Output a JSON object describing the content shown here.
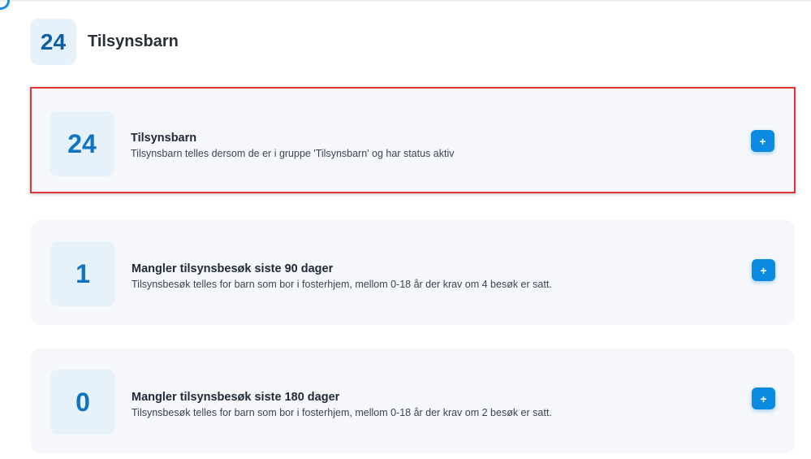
{
  "header": {
    "count": "24",
    "title": "Tilsynsbarn"
  },
  "cards": [
    {
      "count": "24",
      "title": "Tilsynsbarn",
      "description": "Tilsynsbarn telles dersom de er i gruppe 'Tilsynsbarn' og har status aktiv",
      "add_label": "+"
    },
    {
      "count": "1",
      "title": "Mangler tilsynsbesøk siste 90 dager",
      "description": "Tilsynsbesøk telles for barn som bor i fosterhjem, mellom 0-18 år der krav om 4 besøk er satt.",
      "add_label": "+"
    },
    {
      "count": "0",
      "title": "Mangler tilsynsbesøk siste 180 dager",
      "description": "Tilsynsbesøk telles for barn som bor i fosterhjem, mellom 0-18 år der krav om 2 besøk er satt.",
      "add_label": "+"
    }
  ],
  "colors": {
    "accent": "#0a8ae0",
    "count_text": "#0f74c2",
    "highlight_border": "#e0363a",
    "card_bg": "#f5f7fb"
  }
}
